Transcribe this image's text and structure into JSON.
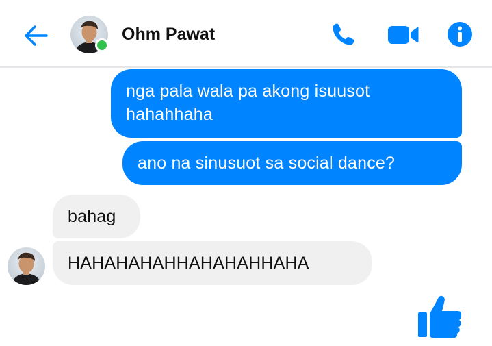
{
  "header": {
    "contact_name": "Ohm Pawat",
    "online": true,
    "icons": {
      "back": "arrow-left-icon",
      "call": "phone-icon",
      "video": "video-camera-icon",
      "info": "info-icon"
    }
  },
  "messages": [
    {
      "direction": "outgoing",
      "lines": [
        "nga pala wala pa akong isuusot",
        "hahahhaha"
      ]
    },
    {
      "direction": "outgoing",
      "text": "ano na sinusuot sa social dance?"
    },
    {
      "direction": "incoming",
      "text": "bahag"
    },
    {
      "direction": "incoming",
      "text": "HAHAHAHAHHAHAHAHHAHA"
    }
  ],
  "composer": {
    "like_icon": "thumbs-up-icon"
  },
  "colors": {
    "accent": "#0084ff",
    "incoming_bubble": "#f1f0f0",
    "online": "#31c24d"
  }
}
